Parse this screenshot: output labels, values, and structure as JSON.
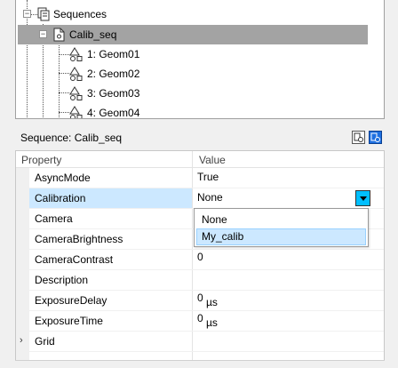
{
  "tree": {
    "items": [
      {
        "label": "Sequences"
      },
      {
        "label": "Calib_seq"
      },
      {
        "label": "1: Geom01"
      },
      {
        "label": "2: Geom02"
      },
      {
        "label": "3: Geom03"
      },
      {
        "label": "4: Geom04"
      }
    ]
  },
  "properties_panel": {
    "title": "Sequence: Calib_seq",
    "columns": {
      "property": "Property",
      "value": "Value"
    },
    "rows": [
      {
        "name": "AsyncMode",
        "value": "True",
        "unit": ""
      },
      {
        "name": "Calibration",
        "value": "None",
        "unit": ""
      },
      {
        "name": "Camera",
        "value": "",
        "unit": ""
      },
      {
        "name": "CameraBrightness",
        "value": "",
        "unit": ""
      },
      {
        "name": "CameraContrast",
        "value": "0",
        "unit": ""
      },
      {
        "name": "Description",
        "value": "",
        "unit": ""
      },
      {
        "name": "ExposureDelay",
        "value": "0",
        "unit": "µs"
      },
      {
        "name": "ExposureTime",
        "value": "0",
        "unit": "µs"
      },
      {
        "name": "Grid",
        "value": "",
        "unit": ""
      }
    ]
  },
  "calibration_dropdown": {
    "options": [
      "None",
      "My_calib"
    ],
    "highlighted": "My_calib"
  },
  "colors": {
    "selection_gray": "#a3a3a3",
    "highlight_blue": "#cce8ff",
    "combo_button": "#00bfff"
  }
}
